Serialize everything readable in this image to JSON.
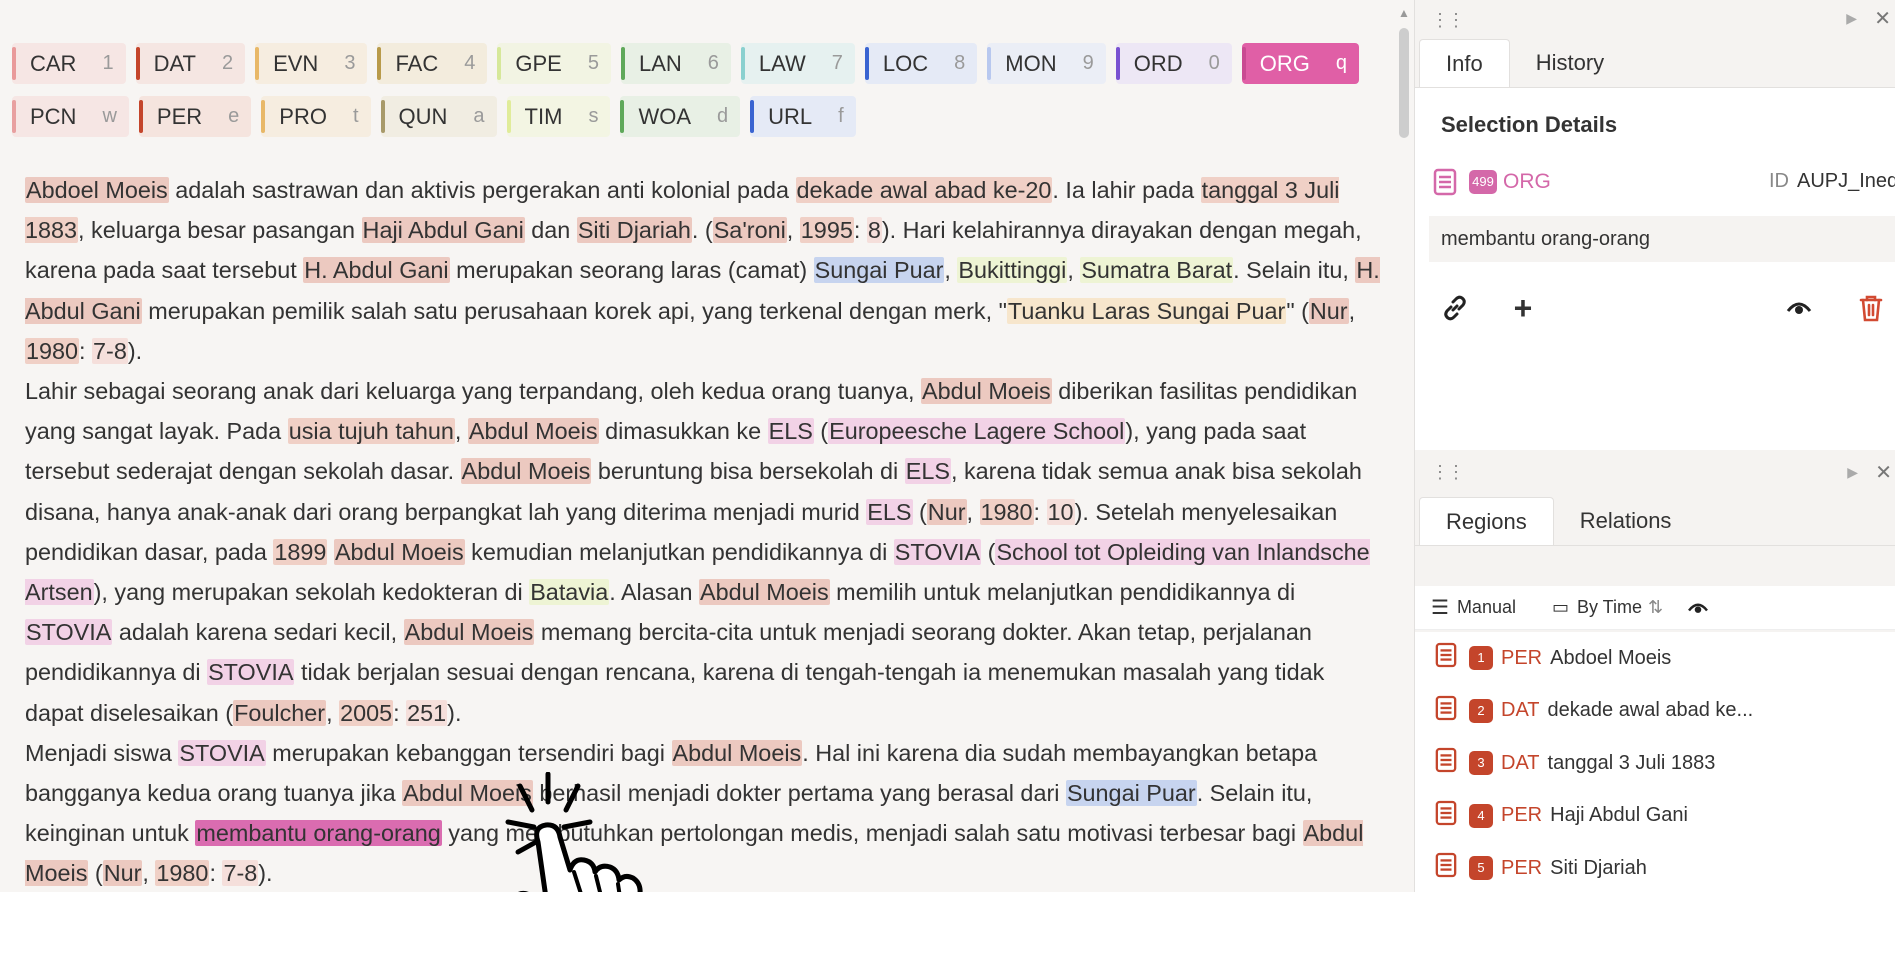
{
  "labels": {
    "row1": [
      {
        "name": "CAR",
        "key": "1",
        "bar": "#e99a9a",
        "bg": "#f6e6e4"
      },
      {
        "name": "DAT",
        "key": "2",
        "bar": "#c4452b",
        "bg": "#f5e6e2"
      },
      {
        "name": "EVN",
        "key": "3",
        "bar": "#e8b868",
        "bg": "#f6ede0"
      },
      {
        "name": "FAC",
        "key": "4",
        "bar": "#b89a4a",
        "bg": "#f3ecdd"
      },
      {
        "name": "GPE",
        "key": "5",
        "bar": "#d6e89a",
        "bg": "#f2f4e3"
      },
      {
        "name": "LAN",
        "key": "6",
        "bar": "#5fa85a",
        "bg": "#e8f0e5"
      },
      {
        "name": "LAW",
        "key": "7",
        "bar": "#8ad0cf",
        "bg": "#e6f1f0"
      },
      {
        "name": "LOC",
        "key": "8",
        "bar": "#3a64d1",
        "bg": "#e5eaf6"
      },
      {
        "name": "MON",
        "key": "9",
        "bar": "#b8c8ef",
        "bg": "#ebeef6"
      },
      {
        "name": "ORD",
        "key": "0",
        "bar": "#7a52d1",
        "bg": "#ede7f5"
      },
      {
        "name": "ORG",
        "key": "q",
        "bar": "#d468a9",
        "bg": "#e05fa6",
        "active": true
      }
    ],
    "row2": [
      {
        "name": "PCN",
        "key": "w",
        "bar": "#e8a0a0",
        "bg": "#f6e6e4"
      },
      {
        "name": "PER",
        "key": "e",
        "bar": "#c4452b",
        "bg": "#f5e4de"
      },
      {
        "name": "PRO",
        "key": "t",
        "bar": "#e8b868",
        "bg": "#f6ede0"
      },
      {
        "name": "QUN",
        "key": "a",
        "bar": "#a89a6a",
        "bg": "#f1ede2"
      },
      {
        "name": "TIM",
        "key": "s",
        "bar": "#e0ec9a",
        "bg": "#f3f5e3"
      },
      {
        "name": "WOA",
        "key": "d",
        "bar": "#5fa85a",
        "bg": "#e8f0e5"
      },
      {
        "name": "URL",
        "key": "f",
        "bar": "#3a64d1",
        "bg": "#e5eaf6"
      }
    ]
  },
  "document": {
    "paragraphs": [
      [
        {
          "t": "Abdoel Moeis",
          "c": "per"
        },
        " adalah sastrawan dan aktivis pergerakan anti kolonial pada ",
        {
          "t": "dekade awal abad ke-20",
          "c": "dat"
        },
        ". Ia lahir pada ",
        {
          "t": "tanggal 3 Juli 1883",
          "c": "dat"
        },
        ", keluarga besar pasangan ",
        {
          "t": "Haji Abdul Gani",
          "c": "per"
        },
        " dan ",
        {
          "t": "Siti Djariah",
          "c": "per"
        },
        ". (",
        {
          "t": "Sa'roni",
          "c": "per"
        },
        ", ",
        {
          "t": "1995",
          "c": "dat"
        },
        ": ",
        {
          "t": "8",
          "c": "num"
        },
        "). Hari kelahirannya dirayakan dengan megah, karena pada saat tersebut ",
        {
          "t": "H. Abdul Gani",
          "c": "per"
        },
        " merupakan seorang laras (camat) ",
        {
          "t": "Sungai Puar",
          "c": "loc"
        },
        ", ",
        {
          "t": "Bukittinggi",
          "c": "gpe"
        },
        ", ",
        {
          "t": "Sumatra Barat",
          "c": "gpe"
        },
        ". Selain itu, ",
        {
          "t": "H. Abdul Gani",
          "c": "per"
        },
        " merupakan pemilik salah satu perusahaan korek api, yang terkenal dengan merk, \"",
        {
          "t": "Tuanku Laras Sungai Puar",
          "c": "pro"
        },
        "\" (",
        {
          "t": "Nur",
          "c": "per"
        },
        ", ",
        {
          "t": "1980",
          "c": "dat"
        },
        ": ",
        {
          "t": "7-8",
          "c": "num"
        },
        ")."
      ],
      [
        "Lahir sebagai seorang anak dari keluarga yang terpandang, oleh kedua orang tuanya, ",
        {
          "t": "Abdul Moeis",
          "c": "per"
        },
        " diberikan fasilitas pendidikan yang sangat layak. Pada ",
        {
          "t": "usia tujuh tahun",
          "c": "dat"
        },
        ", ",
        {
          "t": "Abdul Moeis",
          "c": "per"
        },
        " dimasukkan ke ",
        {
          "t": "ELS",
          "c": "org"
        },
        " (",
        {
          "t": "Europeesche Lagere School",
          "c": "org"
        },
        "), yang pada saat tersebut sederajat dengan sekolah dasar. ",
        {
          "t": "Abdul Moeis",
          "c": "per"
        },
        " beruntung bisa bersekolah di ",
        {
          "t": "ELS",
          "c": "org"
        },
        ", karena tidak semua anak bisa sekolah disana, hanya anak-anak dari orang berpangkat lah yang diterima menjadi murid ",
        {
          "t": "ELS",
          "c": "org"
        },
        " (",
        {
          "t": "Nur",
          "c": "per"
        },
        ", ",
        {
          "t": "1980",
          "c": "dat"
        },
        ": ",
        {
          "t": "10",
          "c": "num"
        },
        "). Setelah menyelesaikan pendidikan dasar, pada ",
        {
          "t": "1899",
          "c": "dat"
        },
        " ",
        {
          "t": "Abdul Moeis",
          "c": "per"
        },
        " kemudian melanjutkan pendidikannya di ",
        {
          "t": "STOVIA",
          "c": "org"
        },
        " (",
        {
          "t": "School tot Opleiding van Inlandsche Artsen",
          "c": "org"
        },
        "), yang merupakan sekolah kedokteran di ",
        {
          "t": "Batavia",
          "c": "gpe"
        },
        ". Alasan ",
        {
          "t": "Abdul Moeis",
          "c": "per"
        },
        " memilih untuk melanjutkan pendidikannya di ",
        {
          "t": "STOVIA",
          "c": "org"
        },
        " adalah karena sedari kecil, ",
        {
          "t": "Abdul Moeis",
          "c": "per"
        },
        " memang bercita-cita untuk menjadi seorang dokter. Akan tetap, perjalanan pendidikannya di ",
        {
          "t": "STOVIA",
          "c": "org"
        },
        " tidak berjalan sesuai dengan rencana, karena di tengah-tengah ia menemukan masalah yang tidak dapat diselesaikan (",
        {
          "t": "Foulcher",
          "c": "per"
        },
        ", ",
        {
          "t": "2005",
          "c": "dat"
        },
        ": ",
        {
          "t": "251",
          "c": "num"
        },
        ")."
      ],
      [
        "Menjadi siswa ",
        {
          "t": "STOVIA",
          "c": "org"
        },
        " merupakan kebanggan tersendiri bagi ",
        {
          "t": "Abdul Moeis",
          "c": "per"
        },
        ". Hal ini karena dia sudah membayangkan betapa bangganya kedua orang tuanya jika ",
        {
          "t": "Abdul Moeis",
          "c": "per"
        },
        " berhasil menjadi dokter pertama yang berasal dari ",
        {
          "t": "Sungai Puar",
          "c": "loc"
        },
        ". Selain itu, keinginan untuk ",
        {
          "t": "membantu orang-orang",
          "c": "sel"
        },
        " yang membutuhkan pertolongan medis, menjadi salah satu motivasi terbesar bagi ",
        {
          "t": "Abdul Moeis",
          "c": "per"
        },
        " (",
        {
          "t": "Nur",
          "c": "per"
        },
        ", ",
        {
          "t": "1980",
          "c": "dat"
        },
        ": ",
        {
          "t": "7-8",
          "c": "num"
        },
        ")."
      ]
    ]
  },
  "info_panel": {
    "tabs": [
      "Info",
      "History"
    ],
    "active_tab": "Info",
    "title": "Selection Details",
    "selection": {
      "count": "499",
      "type": "ORG",
      "id_label": "ID",
      "id": "AUPJ_InedP",
      "text": "membantu orang-orang"
    },
    "actions": [
      "link-icon",
      "plus-icon",
      "eye-icon",
      "trash-icon"
    ]
  },
  "regions_panel": {
    "tabs": [
      "Regions",
      "Relations"
    ],
    "active_tab": "Regions",
    "toolbar": {
      "manual": "Manual",
      "by_time": "By Time"
    },
    "items": [
      {
        "n": "1",
        "type": "PER",
        "text": "Abdoel Moeis"
      },
      {
        "n": "2",
        "type": "DAT",
        "text": "dekade awal abad ke..."
      },
      {
        "n": "3",
        "type": "DAT",
        "text": "tanggal 3 Juli 1883"
      },
      {
        "n": "4",
        "type": "PER",
        "text": "Haji Abdul Gani"
      },
      {
        "n": "5",
        "type": "PER",
        "text": "Siti Djariah"
      }
    ]
  },
  "colors": {
    "accent": "#d468a9",
    "per": "#c4452b"
  }
}
